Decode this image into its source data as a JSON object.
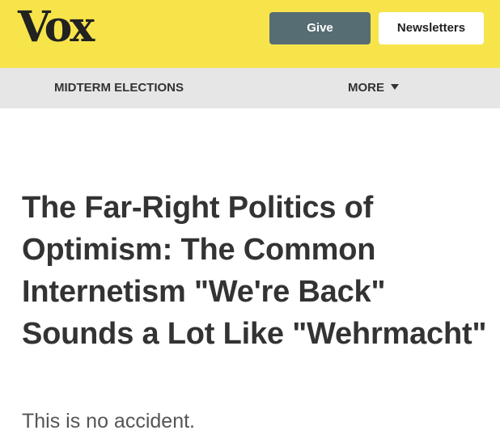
{
  "header": {
    "logo": "Vox",
    "give_label": "Give",
    "newsletters_label": "Newsletters"
  },
  "nav": {
    "section_label": "MIDTERM ELECTIONS",
    "more_label": "MORE"
  },
  "article": {
    "headline": "The Far-Right Politics of Optimism: The Common Internetism \"We're Back\" Sounds a Lot Like \"Wehrmacht\"",
    "dek": "This is no accident."
  },
  "colors": {
    "brand_yellow": "#f7e44b",
    "give_button": "#566d74",
    "nav_background": "#e6e6e6",
    "text": "#333333"
  },
  "icons": {
    "more_caret": "caret-down-icon"
  }
}
